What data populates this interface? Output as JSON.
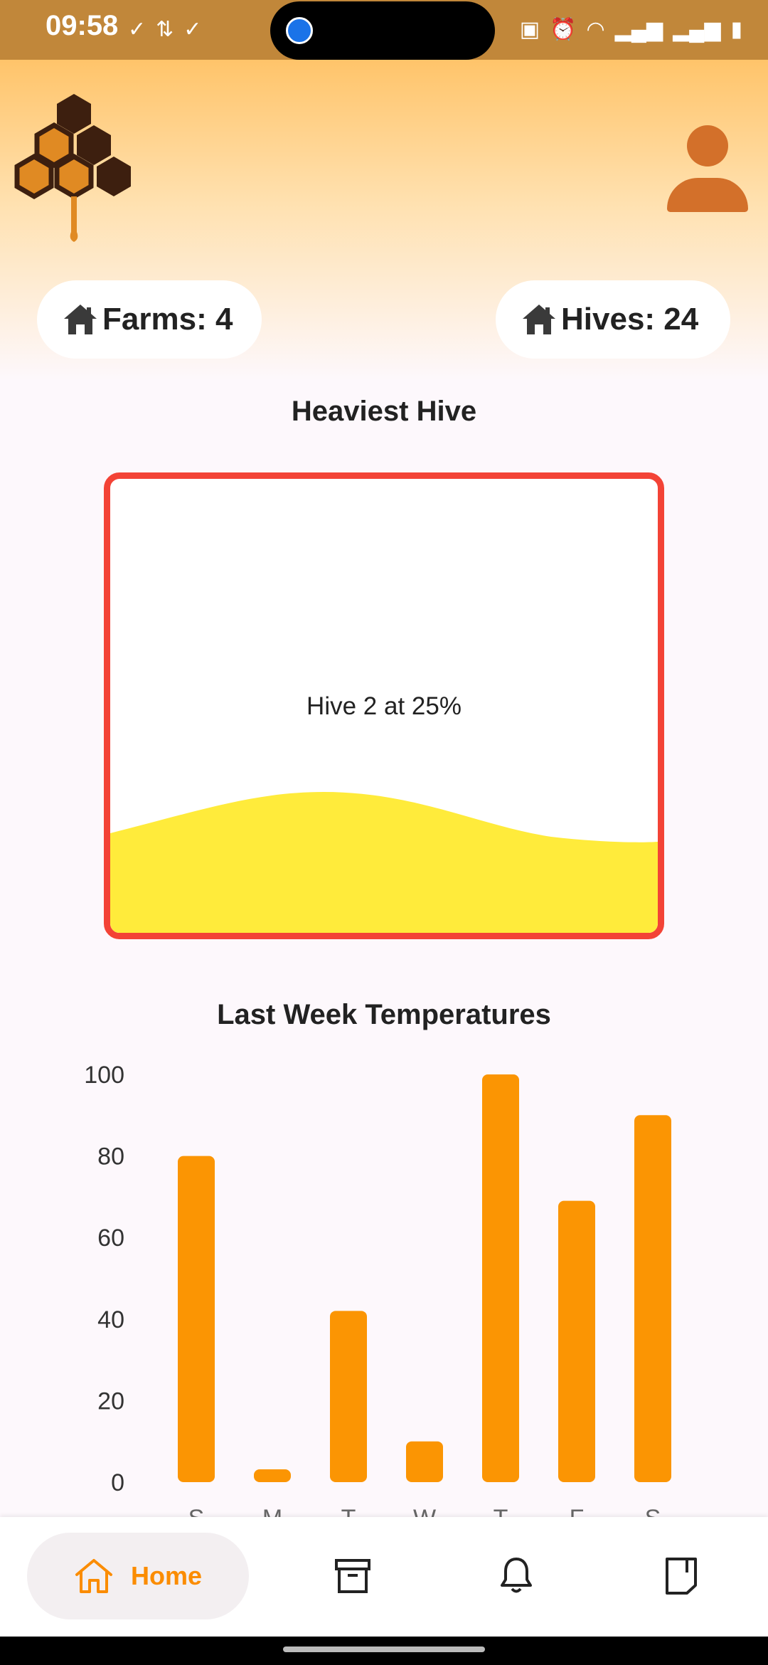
{
  "status_bar": {
    "time": "09:58",
    "left_icons": [
      "check-circle-icon",
      "transfer-icon",
      "check-circle-icon"
    ],
    "right_icons": [
      "battery-saver-icon",
      "alarm-icon",
      "wifi-icon",
      "signal-icon",
      "signal-icon",
      "battery-icon"
    ]
  },
  "stats": {
    "farms_label": "Farms: 4",
    "hives_label": "Hives: 24"
  },
  "heaviest_hive": {
    "title": "Heaviest Hive",
    "text": "Hive 2 at 25%",
    "fill_level": 0.25,
    "border_color": "#f34336",
    "fill_color": "#ffeb3b"
  },
  "chart_data": {
    "type": "bar",
    "title": "Last Week Temperatures",
    "categories": [
      "S",
      "M",
      "T",
      "W",
      "T",
      "F",
      "S"
    ],
    "values": [
      80,
      3,
      42,
      10,
      100,
      69,
      90
    ],
    "ylim": [
      0,
      100
    ],
    "yticks": [
      "0",
      "20",
      "40",
      "60",
      "80",
      "100"
    ],
    "bar_color": "#fb9503",
    "xlabel": "",
    "ylabel": ""
  },
  "nav": {
    "home_label": "Home",
    "items": [
      "home-icon",
      "archive-icon",
      "bell-icon",
      "notebook-icon"
    ],
    "accent": "#fb8c00"
  }
}
